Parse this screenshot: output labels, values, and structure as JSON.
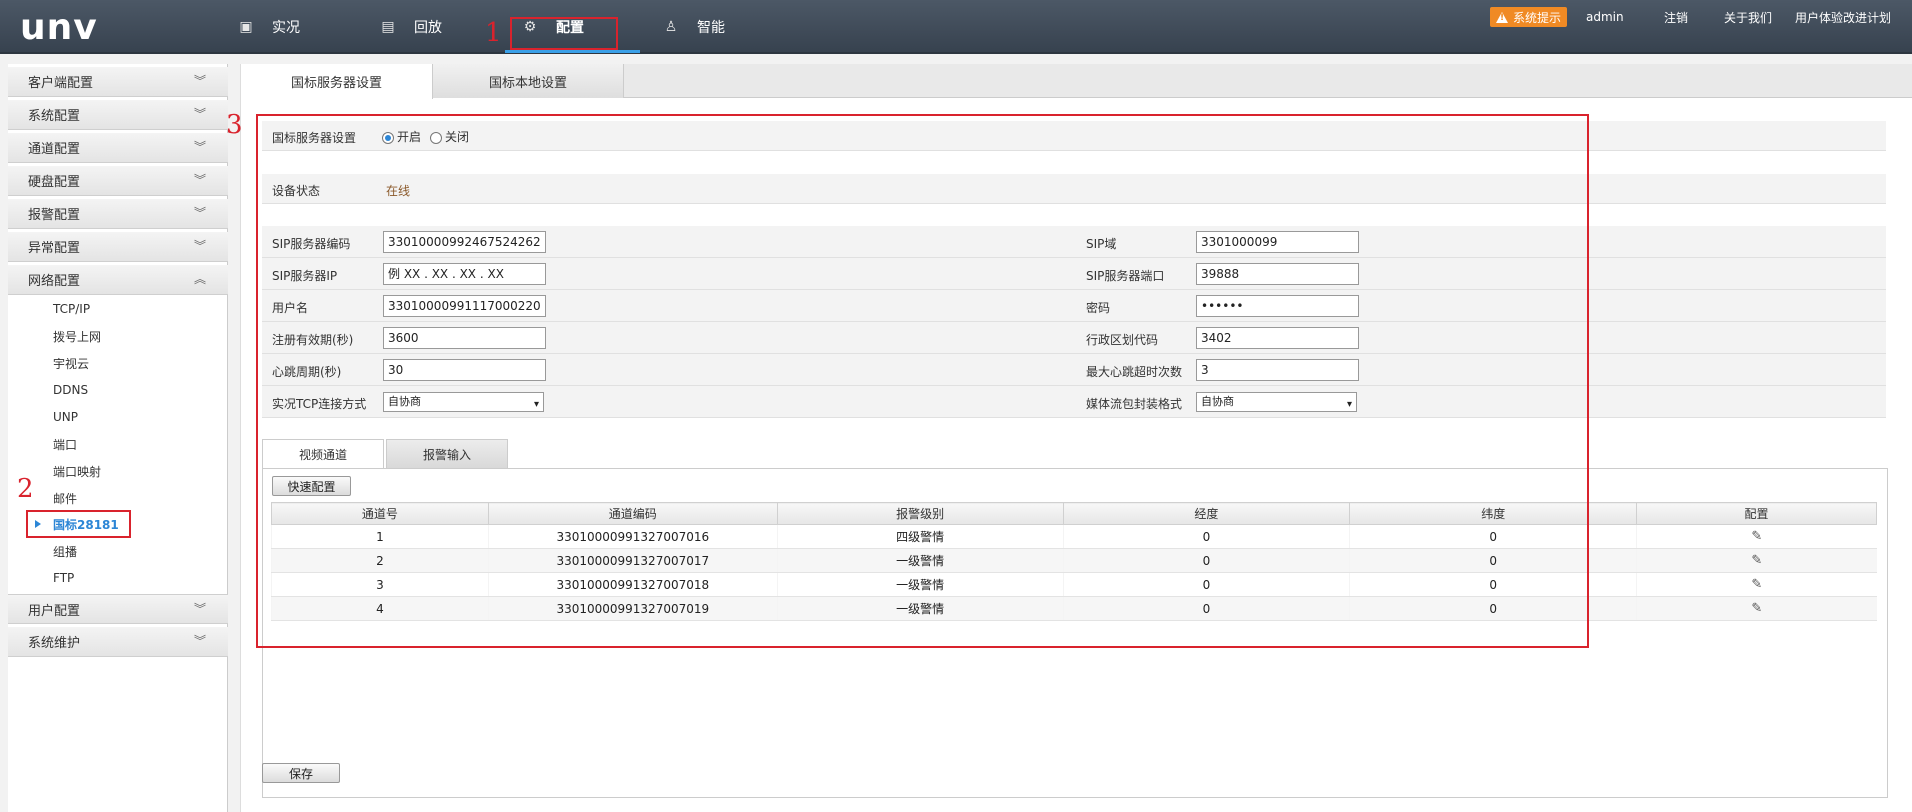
{
  "header": {
    "logo": "unv",
    "nav": [
      {
        "label": "实况",
        "icon": "monitor-icon"
      },
      {
        "label": "回放",
        "icon": "film-icon"
      },
      {
        "label": "配置",
        "icon": "gear-icon"
      },
      {
        "label": "智能",
        "icon": "user-gear-icon"
      }
    ],
    "alert": "系统提示",
    "user": "admin",
    "logout": "注销",
    "about": "关于我们",
    "ux_plan": "用户体验改进计划"
  },
  "annotations": [
    "1",
    "2",
    "3"
  ],
  "sidebar": {
    "groups": [
      {
        "label": "客户端配置"
      },
      {
        "label": "系统配置"
      },
      {
        "label": "通道配置"
      },
      {
        "label": "硬盘配置"
      },
      {
        "label": "报警配置"
      },
      {
        "label": "异常配置"
      },
      {
        "label": "网络配置"
      },
      {
        "label": "用户配置"
      },
      {
        "label": "系统维护"
      }
    ],
    "network_items": [
      "TCP/IP",
      "拨号上网",
      "宇视云",
      "DDNS",
      "UNP",
      "端口",
      "端口映射",
      "邮件",
      "国标28181",
      "组播",
      "FTP"
    ],
    "active_item": "国标28181"
  },
  "tabs": [
    "国标服务器设置",
    "国标本地设置"
  ],
  "form": {
    "server_setting_label": "国标服务器设置",
    "radio_on": "开启",
    "radio_off": "关闭",
    "device_status_label": "设备状态",
    "device_status_value": "在线",
    "sip_server_code_label": "SIP服务器编码",
    "sip_server_code": "33010000992467524262",
    "sip_domain_label": "SIP域",
    "sip_domain": "3301000099",
    "sip_server_ip_label": "SIP服务器IP",
    "sip_server_ip": "例 XX . XX . XX . XX",
    "sip_server_port_label": "SIP服务器端口",
    "sip_server_port": "39888",
    "username_label": "用户名",
    "username": "33010000991117000220",
    "password_label": "密码",
    "password": "••••••",
    "register_period_label": "注册有效期(秒)",
    "register_period": "3600",
    "region_code_label": "行政区划代码",
    "region_code": "3402",
    "heartbeat_label": "心跳周期(秒)",
    "heartbeat": "30",
    "max_heartbeat_timeout_label": "最大心跳超时次数",
    "max_heartbeat_timeout": "3",
    "tcp_mode_label": "实况TCP连接方式",
    "tcp_mode": "自协商",
    "media_format_label": "媒体流包封装格式",
    "media_format": "自协商"
  },
  "subtabs": [
    "视频通道",
    "报警输入"
  ],
  "quick_config": "快速配置",
  "table": {
    "headers": [
      "通道号",
      "通道编码",
      "报警级别",
      "经度",
      "纬度",
      "配置"
    ],
    "rows": [
      {
        "no": "1",
        "code": "33010000991327007016",
        "level": "四级警情",
        "lon": "0",
        "lat": "0"
      },
      {
        "no": "2",
        "code": "33010000991327007017",
        "level": "一级警情",
        "lon": "0",
        "lat": "0"
      },
      {
        "no": "3",
        "code": "33010000991327007018",
        "level": "一级警情",
        "lon": "0",
        "lat": "0"
      },
      {
        "no": "4",
        "code": "33010000991327007019",
        "level": "一级警情",
        "lon": "0",
        "lat": "0"
      }
    ]
  },
  "save": "保存",
  "colors": {
    "accent": "#2c86d6",
    "annotation": "#d9232d",
    "status_online": "#8b5a2b",
    "alert": "#f08a24"
  }
}
